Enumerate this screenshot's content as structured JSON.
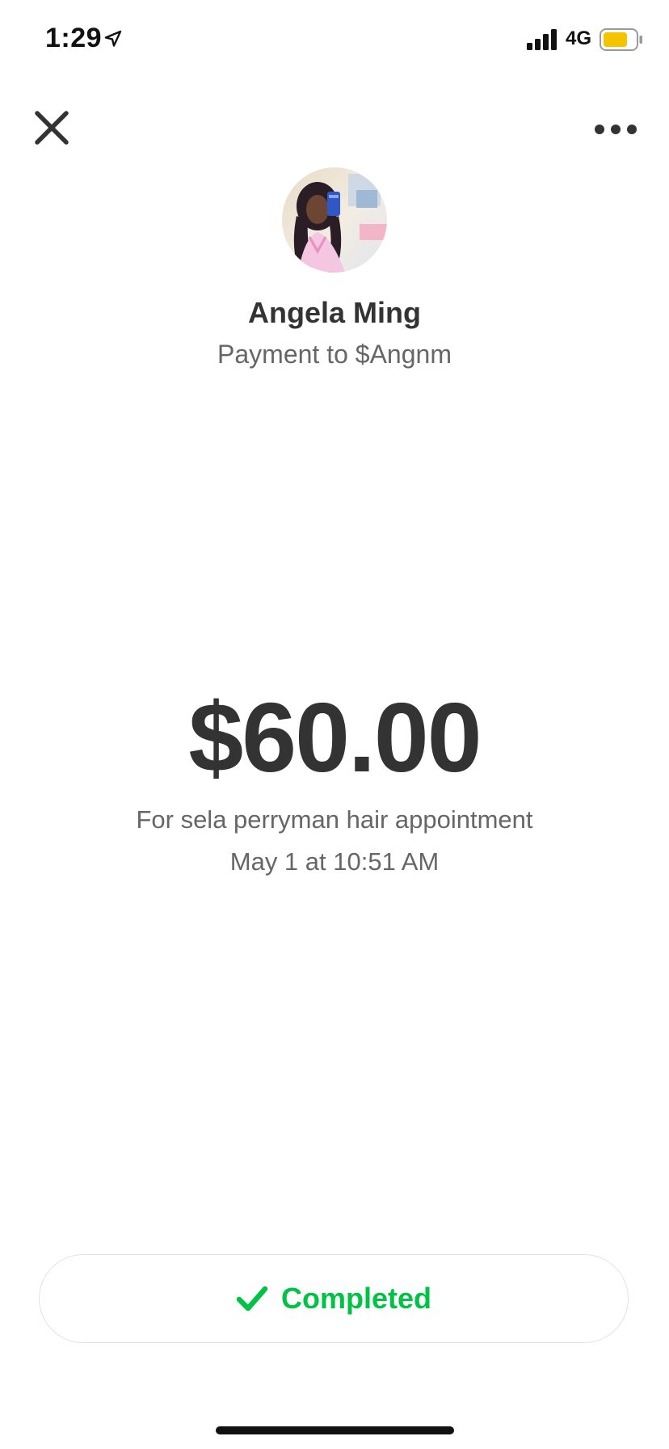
{
  "status_bar": {
    "time": "1:29",
    "network": "4G",
    "location_icon": "location-arrow-icon",
    "signal_icon": "cellular-signal-icon",
    "battery_icon": "battery-icon",
    "battery_color": "#f5c400"
  },
  "header": {
    "close_icon": "close-icon",
    "more_icon": "more-options-icon"
  },
  "recipient": {
    "name": "Angela Ming",
    "subtitle": "Payment to $Angnm",
    "avatar": "avatar-photo"
  },
  "payment": {
    "amount": "$60.00",
    "note": "For sela perryman hair appointment",
    "date": "May 1 at 10:51 AM"
  },
  "status": {
    "label": "Completed",
    "icon": "checkmark-icon",
    "color": "#00c244"
  }
}
